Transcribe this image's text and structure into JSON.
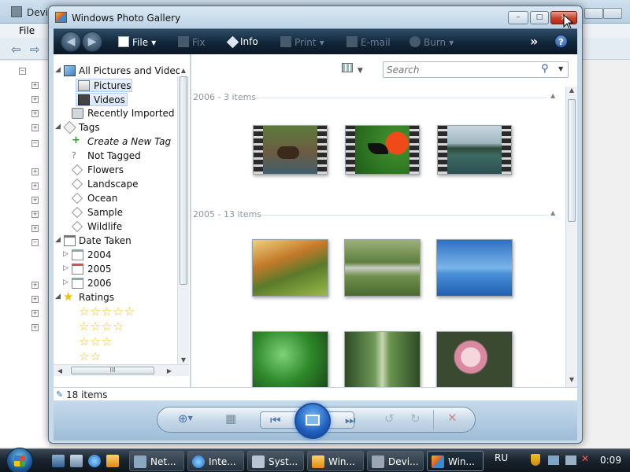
{
  "background_window": {
    "title": "Devi",
    "menu_file": "File"
  },
  "window": {
    "title": "Windows Photo Gallery",
    "buttons": {
      "minimize": "–",
      "maximize": "□",
      "close": "✕"
    }
  },
  "toolbar": {
    "file": "File",
    "fix": "Fix",
    "info": "Info",
    "print": "Print",
    "email": "E-mail",
    "burn": "Burn",
    "more": "»",
    "help": "?"
  },
  "nav": {
    "all_pictures": "All Pictures and Videos",
    "pictures": "Pictures",
    "videos": "Videos",
    "recently_imported": "Recently Imported",
    "tags": "Tags",
    "create_tag": "Create a New Tag",
    "not_tagged": "Not Tagged",
    "tag_flowers": "Flowers",
    "tag_landscape": "Landscape",
    "tag_ocean": "Ocean",
    "tag_sample": "Sample",
    "tag_wildlife": "Wildlife",
    "date_taken": "Date Taken",
    "year_2004": "2004",
    "year_2005": "2005",
    "year_2006": "2006",
    "ratings": "Ratings",
    "scroll_grip": "III"
  },
  "content": {
    "search_placeholder": "Search",
    "group_2006": "2006 - 3 items",
    "group_2005": "2005 - 13 items"
  },
  "status": {
    "count": "18 items"
  },
  "taskbar": {
    "tasks": [
      "Net...",
      "Inte...",
      "Syst...",
      "Win...",
      "Devi...",
      "Win..."
    ],
    "language": "RU",
    "clock": "0:09"
  },
  "colors": {
    "accent": "#1f5fbf",
    "toolbar_dark": "#11263a",
    "close_red": "#c8402a",
    "star": "#f2c200"
  }
}
